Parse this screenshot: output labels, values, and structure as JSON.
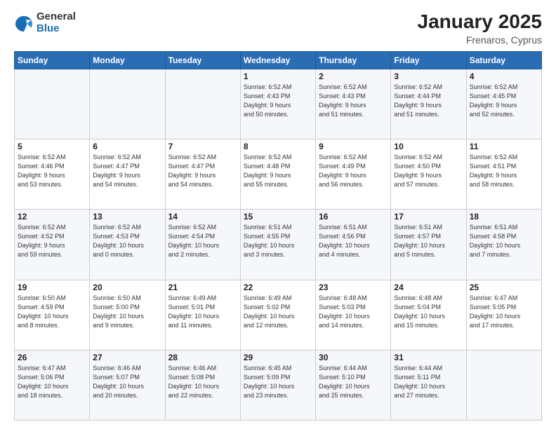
{
  "header": {
    "logo": {
      "general": "General",
      "blue": "Blue"
    },
    "month_year": "January 2025",
    "location": "Frenaros, Cyprus"
  },
  "weekdays": [
    "Sunday",
    "Monday",
    "Tuesday",
    "Wednesday",
    "Thursday",
    "Friday",
    "Saturday"
  ],
  "weeks": [
    [
      {
        "day": "",
        "info": ""
      },
      {
        "day": "",
        "info": ""
      },
      {
        "day": "",
        "info": ""
      },
      {
        "day": "1",
        "info": "Sunrise: 6:52 AM\nSunset: 4:43 PM\nDaylight: 9 hours\nand 50 minutes."
      },
      {
        "day": "2",
        "info": "Sunrise: 6:52 AM\nSunset: 4:43 PM\nDaylight: 9 hours\nand 51 minutes."
      },
      {
        "day": "3",
        "info": "Sunrise: 6:52 AM\nSunset: 4:44 PM\nDaylight: 9 hours\nand 51 minutes."
      },
      {
        "day": "4",
        "info": "Sunrise: 6:52 AM\nSunset: 4:45 PM\nDaylight: 9 hours\nand 52 minutes."
      }
    ],
    [
      {
        "day": "5",
        "info": "Sunrise: 6:52 AM\nSunset: 4:46 PM\nDaylight: 9 hours\nand 53 minutes."
      },
      {
        "day": "6",
        "info": "Sunrise: 6:52 AM\nSunset: 4:47 PM\nDaylight: 9 hours\nand 54 minutes."
      },
      {
        "day": "7",
        "info": "Sunrise: 6:52 AM\nSunset: 4:47 PM\nDaylight: 9 hours\nand 54 minutes."
      },
      {
        "day": "8",
        "info": "Sunrise: 6:52 AM\nSunset: 4:48 PM\nDaylight: 9 hours\nand 55 minutes."
      },
      {
        "day": "9",
        "info": "Sunrise: 6:52 AM\nSunset: 4:49 PM\nDaylight: 9 hours\nand 56 minutes."
      },
      {
        "day": "10",
        "info": "Sunrise: 6:52 AM\nSunset: 4:50 PM\nDaylight: 9 hours\nand 57 minutes."
      },
      {
        "day": "11",
        "info": "Sunrise: 6:52 AM\nSunset: 4:51 PM\nDaylight: 9 hours\nand 58 minutes."
      }
    ],
    [
      {
        "day": "12",
        "info": "Sunrise: 6:52 AM\nSunset: 4:52 PM\nDaylight: 9 hours\nand 59 minutes."
      },
      {
        "day": "13",
        "info": "Sunrise: 6:52 AM\nSunset: 4:53 PM\nDaylight: 10 hours\nand 0 minutes."
      },
      {
        "day": "14",
        "info": "Sunrise: 6:52 AM\nSunset: 4:54 PM\nDaylight: 10 hours\nand 2 minutes."
      },
      {
        "day": "15",
        "info": "Sunrise: 6:51 AM\nSunset: 4:55 PM\nDaylight: 10 hours\nand 3 minutes."
      },
      {
        "day": "16",
        "info": "Sunrise: 6:51 AM\nSunset: 4:56 PM\nDaylight: 10 hours\nand 4 minutes."
      },
      {
        "day": "17",
        "info": "Sunrise: 6:51 AM\nSunset: 4:57 PM\nDaylight: 10 hours\nand 5 minutes."
      },
      {
        "day": "18",
        "info": "Sunrise: 6:51 AM\nSunset: 4:58 PM\nDaylight: 10 hours\nand 7 minutes."
      }
    ],
    [
      {
        "day": "19",
        "info": "Sunrise: 6:50 AM\nSunset: 4:59 PM\nDaylight: 10 hours\nand 8 minutes."
      },
      {
        "day": "20",
        "info": "Sunrise: 6:50 AM\nSunset: 5:00 PM\nDaylight: 10 hours\nand 9 minutes."
      },
      {
        "day": "21",
        "info": "Sunrise: 6:49 AM\nSunset: 5:01 PM\nDaylight: 10 hours\nand 11 minutes."
      },
      {
        "day": "22",
        "info": "Sunrise: 6:49 AM\nSunset: 5:02 PM\nDaylight: 10 hours\nand 12 minutes."
      },
      {
        "day": "23",
        "info": "Sunrise: 6:48 AM\nSunset: 5:03 PM\nDaylight: 10 hours\nand 14 minutes."
      },
      {
        "day": "24",
        "info": "Sunrise: 6:48 AM\nSunset: 5:04 PM\nDaylight: 10 hours\nand 15 minutes."
      },
      {
        "day": "25",
        "info": "Sunrise: 6:47 AM\nSunset: 5:05 PM\nDaylight: 10 hours\nand 17 minutes."
      }
    ],
    [
      {
        "day": "26",
        "info": "Sunrise: 6:47 AM\nSunset: 5:06 PM\nDaylight: 10 hours\nand 18 minutes."
      },
      {
        "day": "27",
        "info": "Sunrise: 6:46 AM\nSunset: 5:07 PM\nDaylight: 10 hours\nand 20 minutes."
      },
      {
        "day": "28",
        "info": "Sunrise: 6:46 AM\nSunset: 5:08 PM\nDaylight: 10 hours\nand 22 minutes."
      },
      {
        "day": "29",
        "info": "Sunrise: 6:45 AM\nSunset: 5:09 PM\nDaylight: 10 hours\nand 23 minutes."
      },
      {
        "day": "30",
        "info": "Sunrise: 6:44 AM\nSunset: 5:10 PM\nDaylight: 10 hours\nand 25 minutes."
      },
      {
        "day": "31",
        "info": "Sunrise: 6:44 AM\nSunset: 5:11 PM\nDaylight: 10 hours\nand 27 minutes."
      },
      {
        "day": "",
        "info": ""
      }
    ]
  ]
}
